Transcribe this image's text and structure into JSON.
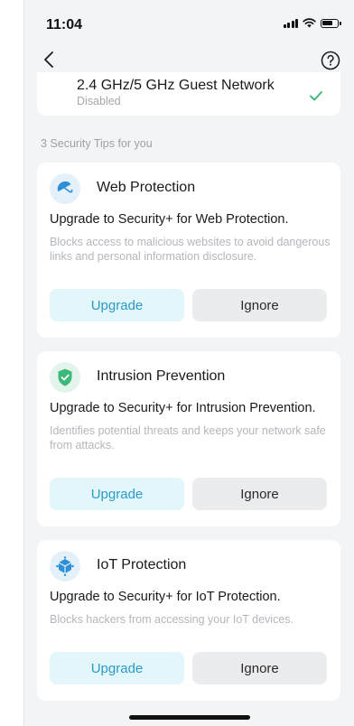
{
  "status_bar": {
    "time": "11:04",
    "icons": [
      "cellular-signal-icon",
      "wifi-icon",
      "battery-icon"
    ]
  },
  "nav": {
    "back_icon": "chevron-left-icon",
    "help_icon": "help-circle-icon"
  },
  "guest_network": {
    "title": "2.4 GHz/5 GHz Guest Network",
    "status": "Disabled",
    "state_icon": "checkmark-icon",
    "accent_color": "#3cb879"
  },
  "tips_section": {
    "title": "3 Security Tips for you"
  },
  "tips": [
    {
      "name": "Web Protection",
      "icon": "umbrella-icon",
      "headline": "Upgrade to Security+ for Web Protection.",
      "description": "Blocks access to malicious websites to avoid dangerous links and personal information disclosure.",
      "upgrade_label": "Upgrade",
      "ignore_label": "Ignore"
    },
    {
      "name": "Intrusion Prevention",
      "icon": "shield-check-icon",
      "headline": "Upgrade to Security+ for Intrusion Prevention.",
      "description": "Identifies potential threats and keeps your network safe from attacks.",
      "upgrade_label": "Upgrade",
      "ignore_label": "Ignore"
    },
    {
      "name": "IoT Protection",
      "icon": "iot-cube-icon",
      "headline": "Upgrade to Security+ for IoT Protection.",
      "description": "Blocks hackers from accessing your IoT devices.",
      "upgrade_label": "Upgrade",
      "ignore_label": "Ignore"
    }
  ],
  "colors": {
    "background": "#f3f4f6",
    "card": "#ffffff",
    "upgrade_bg": "#e3f6fa",
    "upgrade_text": "#2a9bc9",
    "ignore_bg": "#ebecee",
    "shield_green": "#3cb879",
    "icon_blue": "#2f8fd8"
  }
}
